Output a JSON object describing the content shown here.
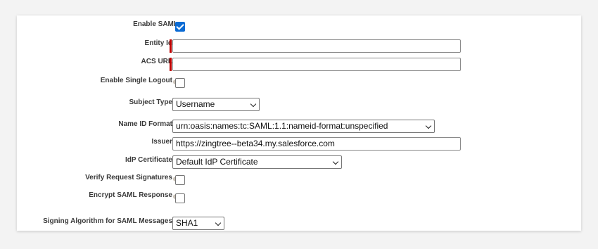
{
  "fields": {
    "enable_saml": {
      "label": "Enable SAML",
      "checked": true
    },
    "entity_id": {
      "label": "Entity Id",
      "value": ""
    },
    "acs_url": {
      "label": "ACS URL",
      "value": ""
    },
    "enable_single_logout": {
      "label": "Enable Single Logout",
      "checked": false
    },
    "subject_type": {
      "label": "Subject Type",
      "value": "Username"
    },
    "name_id_format": {
      "label": "Name ID Format",
      "value": "urn:oasis:names:tc:SAML:1.1:nameid-format:unspecified"
    },
    "issuer": {
      "label": "Issuer",
      "value": "https://zingtree--beta34.my.salesforce.com"
    },
    "idp_certificate": {
      "label": "IdP Certificate",
      "value": "Default IdP Certificate"
    },
    "verify_request_signatures": {
      "label": "Verify Request Signatures",
      "checked": false
    },
    "encrypt_saml_response": {
      "label": "Encrypt SAML Response",
      "checked": false
    },
    "signing_algorithm": {
      "label": "Signing Algorithm for SAML Messages",
      "value": "SHA1"
    }
  },
  "help_icon_glyph": "?",
  "colors": {
    "checkbox_checked": "#0b6bd4",
    "required_marker": "#c00000",
    "help_icon": "#c9c1b6"
  }
}
